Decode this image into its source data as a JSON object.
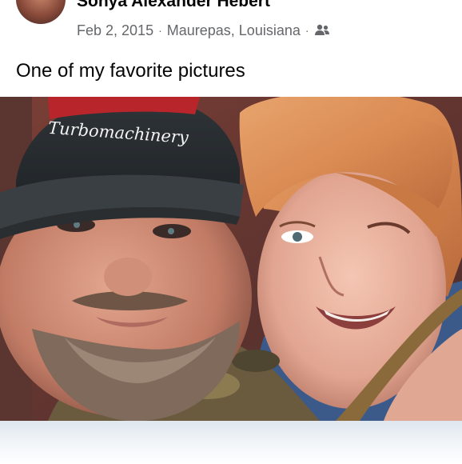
{
  "post": {
    "author": "Sonya Alexander Hebert",
    "date": "Feb 2, 2015",
    "location": "Maurepas, Louisiana",
    "separator": "·",
    "audience_icon": "friends-icon",
    "text": "One of my favorite pictures"
  },
  "photo": {
    "cap_text": "Turbomachinery",
    "description_icon": "photo"
  }
}
